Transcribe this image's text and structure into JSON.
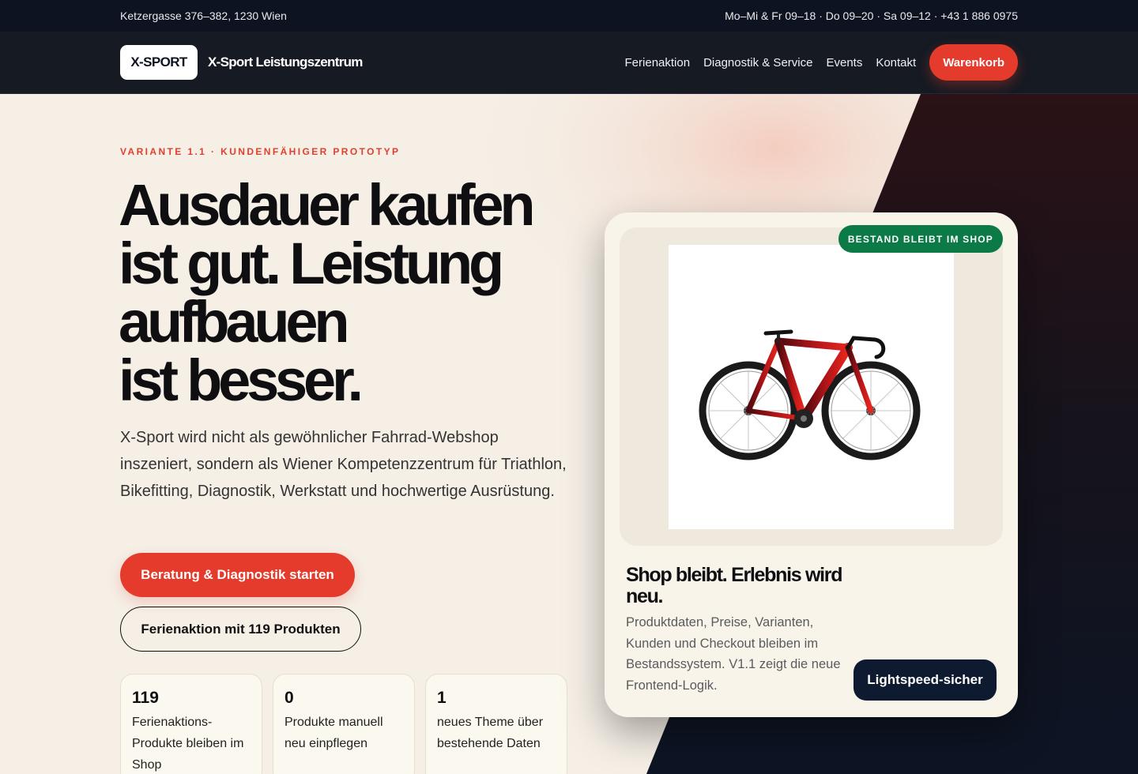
{
  "topbar": {
    "address": "Ketzergasse 376–382, 1230 Wien",
    "hours": "Mo–Mi & Fr 09–18 · Do 09–20 · Sa 09–12 · +43 1 886 0975"
  },
  "header": {
    "logo": "X-SPORT",
    "brand_name": "X-Sport Leistungszentrum",
    "nav": [
      "Ferienaktion",
      "Diagnostik & Service",
      "Events",
      "Kontakt"
    ],
    "cart_label": "Warenkorb"
  },
  "hero": {
    "eyebrow": "Variante 1.1 · Kundenfähiger Prototyp",
    "headline_lines": [
      "Ausdauer kaufen",
      "ist gut. Leistung",
      "aufbauen",
      "ist besser."
    ],
    "lede": "X-Sport wird nicht als gewöhnlicher Fahrrad-Webshop inszeniert, sondern als Wiener Kompetenzzentrum für Triathlon, Bikefitting, Diagnostik, Werkstatt und hochwertige Ausrüstung.",
    "primary_cta": "Beratung & Diagnostik starten",
    "secondary_cta": "Ferienaktion mit 119 Produkten",
    "stats": [
      {
        "value": "119",
        "label": "Ferienaktions-Produkte bleiben im Shop"
      },
      {
        "value": "0",
        "label": "Produkte manuell neu einpflegen"
      },
      {
        "value": "1",
        "label": "neues Theme über bestehende Daten"
      }
    ]
  },
  "card": {
    "badge": "Bestand bleibt im Shop",
    "title": "Shop bleibt. Erlebnis wird neu.",
    "text": "Produktdaten, Preise, Varianten, Kunden und Checkout bleiben im Bestandssystem. V1.1 zeigt die neue Frontend-Logik.",
    "pill": "Lightspeed-sicher",
    "image": "road-bike-red-black"
  },
  "colors": {
    "accent": "#e53b2c",
    "dark": "#0d1320",
    "badge_green": "#0b7a47",
    "background": "#f5efe6"
  }
}
